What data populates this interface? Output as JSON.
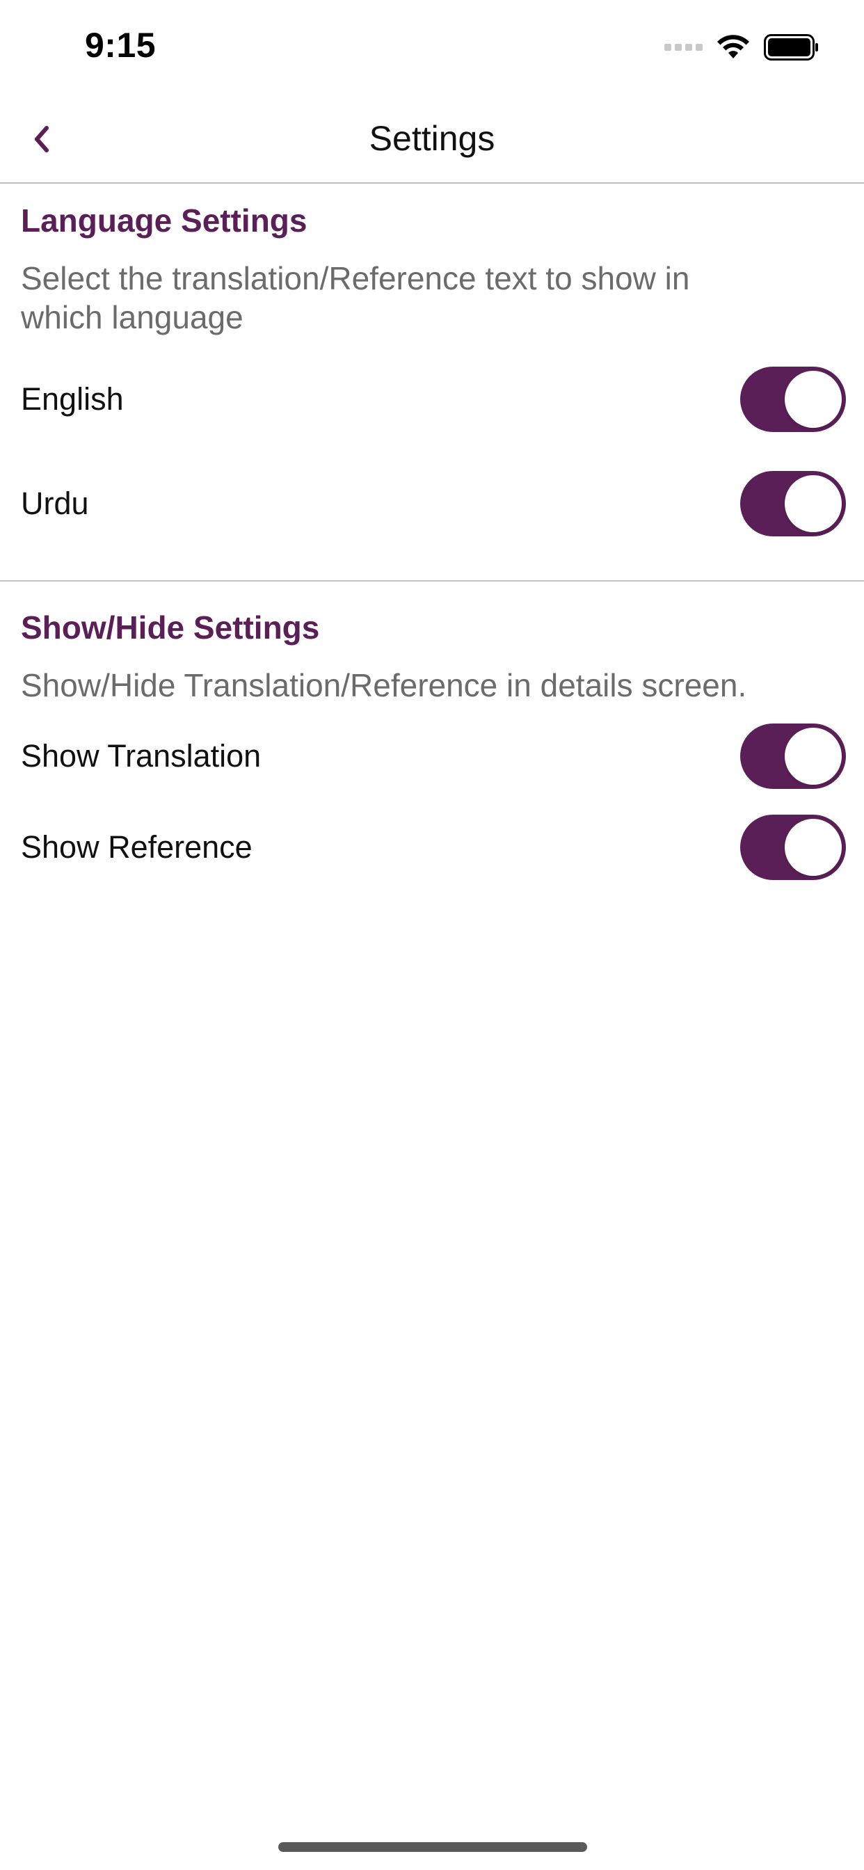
{
  "status_bar": {
    "time": "9:15",
    "icons": [
      "signal-icon",
      "wifi-icon",
      "battery-icon"
    ]
  },
  "nav": {
    "title": "Settings",
    "back_icon": "chevron-left-icon"
  },
  "colors": {
    "accent": "#5b1f57",
    "description": "#6b6b6b",
    "divider": "#c4c4c4"
  },
  "language_section": {
    "title": "Language Settings",
    "description": "Select the translation/Reference text to show in which language",
    "items": [
      {
        "label": "English",
        "enabled": true
      },
      {
        "label": "Urdu",
        "enabled": true
      }
    ]
  },
  "showhide_section": {
    "title": "Show/Hide Settings",
    "description": "Show/Hide Translation/Reference in details screen.",
    "items": [
      {
        "label": "Show Translation",
        "enabled": true
      },
      {
        "label": "Show Reference",
        "enabled": true
      }
    ]
  }
}
